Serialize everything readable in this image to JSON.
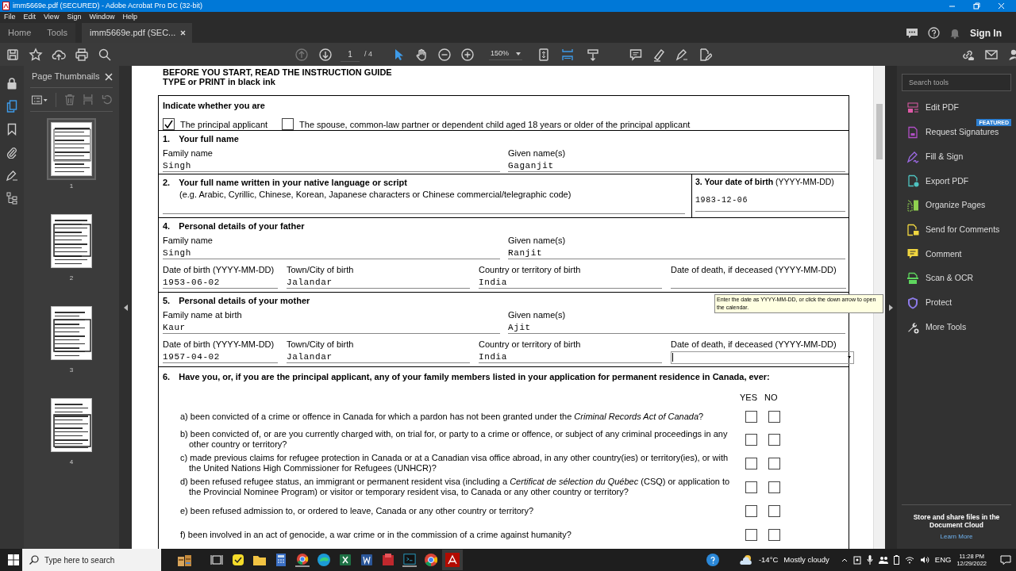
{
  "window": {
    "title": "imm5669e.pdf (SECURED) - Adobe Acrobat Pro DC (32-bit)"
  },
  "menu": [
    "File",
    "Edit",
    "View",
    "Sign",
    "Window",
    "Help"
  ],
  "nav_tabs": [
    {
      "label": "Home",
      "selected": false,
      "kind": "nav"
    },
    {
      "label": "Tools",
      "selected": false,
      "kind": "nav"
    },
    {
      "label": "imm5669e.pdf (SEC...",
      "selected": true,
      "kind": "file"
    }
  ],
  "sign_in": "Sign In",
  "toolbar": {
    "page": "1",
    "page_total": "/ 4",
    "zoom": "150%"
  },
  "left_panel": {
    "title": "Page Thumbnails",
    "thumbnails": [
      {
        "label": "1",
        "selected": true
      },
      {
        "label": "2",
        "selected": false
      },
      {
        "label": "3",
        "selected": false
      },
      {
        "label": "4",
        "selected": false
      }
    ]
  },
  "document": {
    "header": [
      "BEFORE YOU START, READ THE INSTRUCTION GUIDE",
      "TYPE or PRINT in black ink"
    ],
    "applicant": {
      "prompt": "Indicate whether you are",
      "options": [
        {
          "label": "The principal applicant",
          "checked": true
        },
        {
          "label": "The spouse, common-law partner or dependent child aged 18 years or older of the principal applicant",
          "checked": false
        }
      ]
    },
    "name_section": {
      "number": "1.",
      "title": "Your full name",
      "fields": [
        {
          "label": "Family name",
          "value": "Singh"
        },
        {
          "label": "Given name(s)",
          "value": "Gaganjit"
        }
      ]
    },
    "native_name": {
      "number": "2.",
      "title": "Your full name written in your native language or script",
      "note": "(e.g. Arabic, Cyrillic, Chinese, Korean, Japanese characters or Chinese commercial/telegraphic code)"
    },
    "birth_date": {
      "label": "**3. Your date of birth** (YYYY-MM-DD)",
      "value": "1983-12-06"
    },
    "parents": [
      {
        "number": "4.",
        "title": "Personal details of your father",
        "name_fields": [
          {
            "label": "Family name",
            "value": "Singh"
          },
          {
            "label": "Given name(s)",
            "value": "Ranjit"
          }
        ],
        "detail_fields": [
          {
            "label": "Date of birth (YYYY-MM-DD)",
            "value": "1953-06-02",
            "focused": false
          },
          {
            "label": "Town/City of birth",
            "value": "Jalandar",
            "focused": false
          },
          {
            "label": "Country or territory of birth",
            "value": "India",
            "focused": false
          },
          {
            "label": "Date of death, if deceased (YYYY-MM-DD)",
            "focused": false
          }
        ]
      },
      {
        "number": "5.",
        "title": "Personal details of your mother",
        "name_fields": [
          {
            "label": "Family name at birth",
            "value": "Kaur"
          },
          {
            "label": "Given name(s)",
            "value": "Ajit"
          }
        ],
        "detail_fields": [
          {
            "label": "Date of birth (YYYY-MM-DD)",
            "value": "1957-04-02",
            "focused": false
          },
          {
            "label": "Town/City of birth",
            "value": "Jalandar",
            "focused": false
          },
          {
            "label": "Country or territory of birth",
            "value": "India",
            "focused": false
          },
          {
            "label": "Date of death, if deceased (YYYY-MM-DD)",
            "focused": true
          }
        ]
      }
    ],
    "history": {
      "number": "6.",
      "title": "Have you, or, if you are the principal applicant, any of your family members listed in your application for permanent residence in Canada, ever:",
      "yes": "YES",
      "no": "NO",
      "questions": [
        {
          "text": "a) been convicted  of a crime or offence in Canada for which a pardon has not been granted under the *Criminal Records Act of Canada*?",
          "yes": false,
          "no": false
        },
        {
          "text": "b) been convicted of, or are you currently charged with, on trial for, or party to a crime or offence, or subject of any criminal proceedings in any other country or territory?",
          "yes": false,
          "no": false
        },
        {
          "text": "c) made previous claims for refugee protection in Canada or at a Canadian visa office abroad, in any other country(ies) or territory(ies), or with the United Nations High Commissioner for Refugees (UNHCR)?",
          "yes": false,
          "no": false
        },
        {
          "text": "d) been refused refugee status, an immigrant or permanent resident visa (including a *Certificat de sélection du Québec* (CSQ) or application to the Provincial Nominee Program) or visitor or temporary resident visa, to Canada or any other country or territory?",
          "yes": false,
          "no": false
        },
        {
          "text": "e) been refused admission to, or ordered to leave, Canada or any other country or territory?",
          "yes": false,
          "no": false
        },
        {
          "text": "f) been involved in an act of genocide, a war crime or in the commission of a crime against humanity?",
          "yes": false,
          "no": false
        }
      ]
    }
  },
  "tooltip": "Enter the date as YYYY-MM-DD, or click the down arrow to open the calendar.",
  "tools_panel": {
    "search_placeholder": "Search tools",
    "tools": [
      {
        "label": "Edit PDF",
        "color": "#e05aa8"
      },
      {
        "label": "Request Signatures",
        "color": "#b14fc5",
        "badge": "FEATURED"
      },
      {
        "label": "Fill & Sign",
        "color": "#9f6be8"
      },
      {
        "label": "Export PDF",
        "color": "#4ec3c0"
      },
      {
        "label": "Organize Pages",
        "color": "#8fd14f"
      },
      {
        "label": "Send for Comments",
        "color": "#f0d640"
      },
      {
        "label": "Comment",
        "color": "#f0d640"
      },
      {
        "label": "Scan & OCR",
        "color": "#5ed65e"
      },
      {
        "label": "Protect",
        "color": "#8d7be8"
      },
      {
        "label": "More Tools",
        "color": "#d8d8d8"
      }
    ],
    "cloud_text": "Store and share files in the Document Cloud",
    "learn_more": "Learn More"
  },
  "taskbar": {
    "search_placeholder": "Type here to search",
    "weather_temp": "-14°C",
    "weather_text": "Mostly cloudy",
    "language": "ENG",
    "time": "11:28 PM",
    "date": "12/29/2022"
  }
}
